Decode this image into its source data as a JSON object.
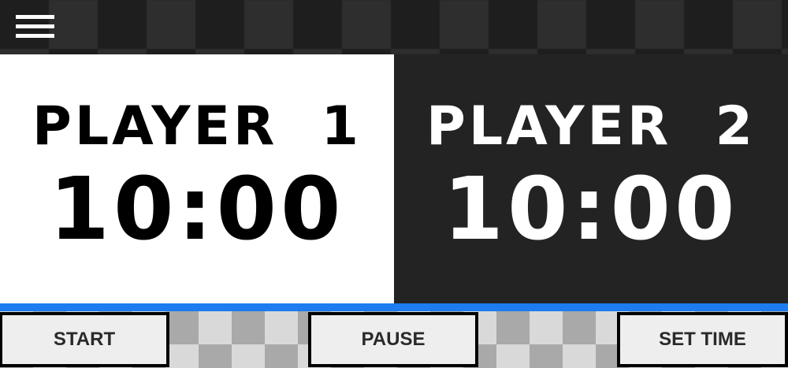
{
  "menu": {
    "icon": "menu-icon"
  },
  "players": [
    {
      "name": "PLAYER  1",
      "time": "10:00",
      "background": "#ffffff",
      "color": "#000000"
    },
    {
      "name": "PLAYER  2",
      "time": "10:00",
      "background": "#232323",
      "color": "#ffffff"
    }
  ],
  "colors": {
    "accent": "#1e7bf0"
  },
  "controls": {
    "start_label": "START",
    "pause_label": "PAUSE",
    "set_time_label": "SET TIME"
  }
}
